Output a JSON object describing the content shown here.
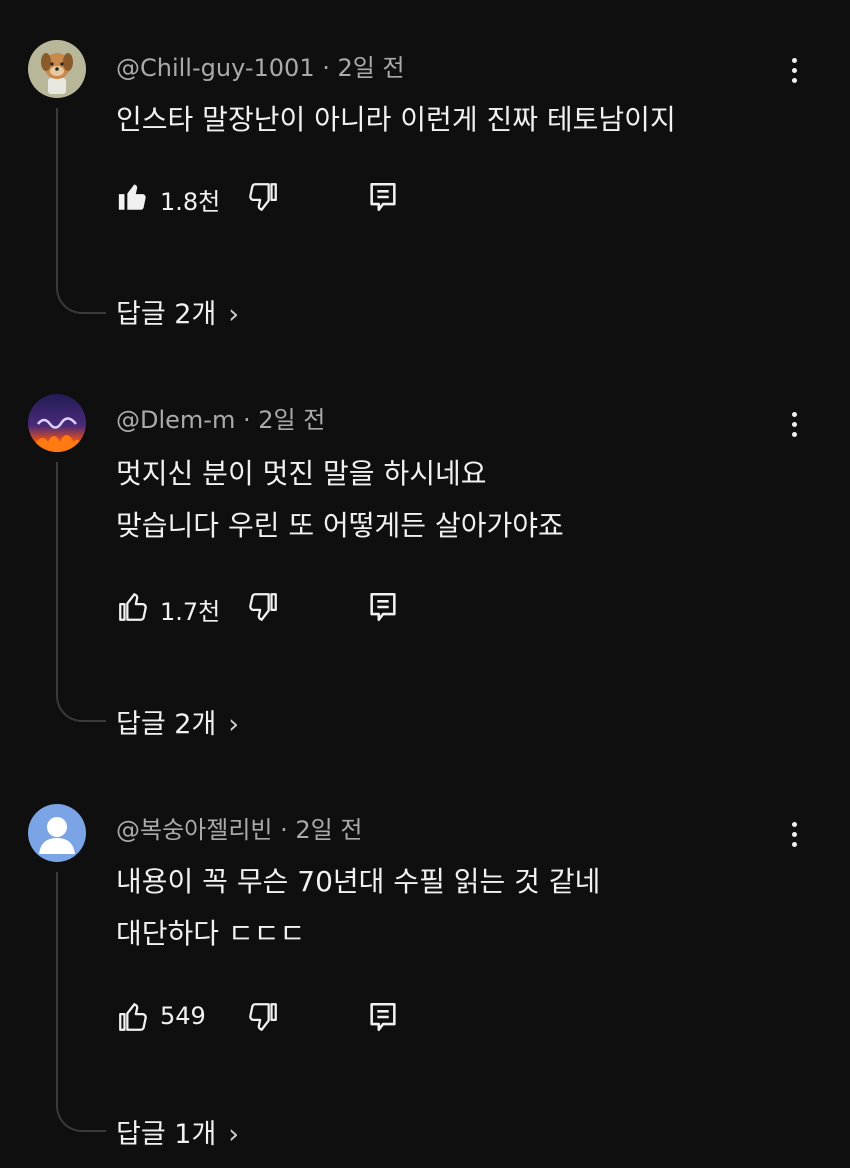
{
  "comments": [
    {
      "author": "@Chill-guy-1001",
      "time": "2일 전",
      "lines": [
        "인스타 말장난이 아니라 이런게 진짜 테토남이지"
      ],
      "likes": "1.8천",
      "liked": true,
      "replies": "답글 2개",
      "avatar": "dog-avatar"
    },
    {
      "author": "@Dlem-m",
      "time": "2일 전",
      "lines": [
        "멋지신 분이 멋진 말을 하시네요",
        "맞습니다 우린 또 어떻게든 살아가야죠"
      ],
      "likes": "1.7천",
      "liked": false,
      "replies": "답글 2개",
      "avatar": "fire-avatar"
    },
    {
      "author": "@복숭아젤리빈",
      "time": "2일 전",
      "lines": [
        "내용이 꼭 무슨 70년대 수필 읽는 것 같네",
        "대단하다 ㄷㄷㄷ"
      ],
      "likes": "549",
      "liked": false,
      "replies": "답글 1개",
      "avatar": "default-avatar"
    }
  ],
  "separator": "·",
  "chevron": "›",
  "colors": {
    "background": "#0f0f0f",
    "text_primary": "#f1f1f1",
    "text_secondary": "#aaaaaa",
    "default_avatar": "#7ba4e6"
  }
}
